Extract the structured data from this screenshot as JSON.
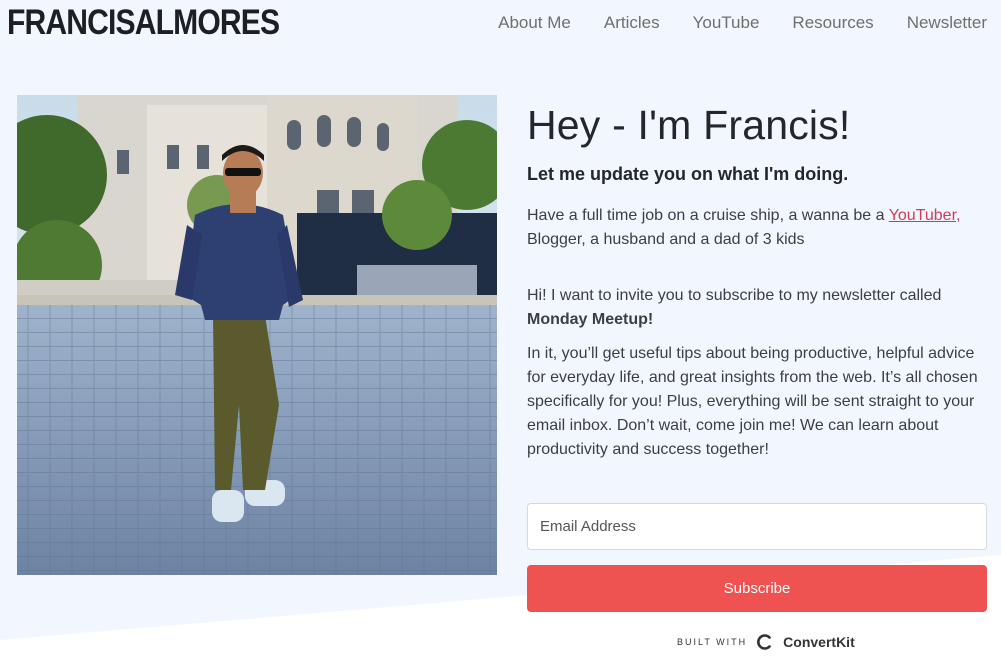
{
  "header": {
    "logo": "FRANCISALMORES",
    "nav": [
      "About Me",
      "Articles",
      "YouTube",
      "Resources",
      "Newsletter"
    ]
  },
  "hero": {
    "title": "Hey - I'm Francis!",
    "subtitle": "Let me update you on what I'm doing.",
    "intro_before_link": "Have a full time job on a cruise ship, a wanna be a ",
    "intro_link": "YouTuber,",
    "intro_after_link": " Blogger, a husband and a dad of 3 kids",
    "invite_text": "Hi! I want to invite you to subscribe to my newsletter called ",
    "newsletter_name": "Monday Meetup!",
    "description": "In it, you’ll get useful tips about being productive, helpful advice for everyday life, and great insights from the web. It’s all chosen specifically for you! Plus, everything will be sent straight to your email inbox. Don’t wait, come join me! We can learn about productivity and success together!"
  },
  "form": {
    "email_placeholder": "Email Address",
    "subscribe_label": "Subscribe"
  },
  "footer": {
    "built_with": "BUILT WITH",
    "provider": "ConvertKit",
    "provider_icon": "convertkit-logo-icon"
  },
  "colors": {
    "background": "#f2f6fe",
    "accent_button": "#ee5351",
    "link": "#d43a55"
  }
}
